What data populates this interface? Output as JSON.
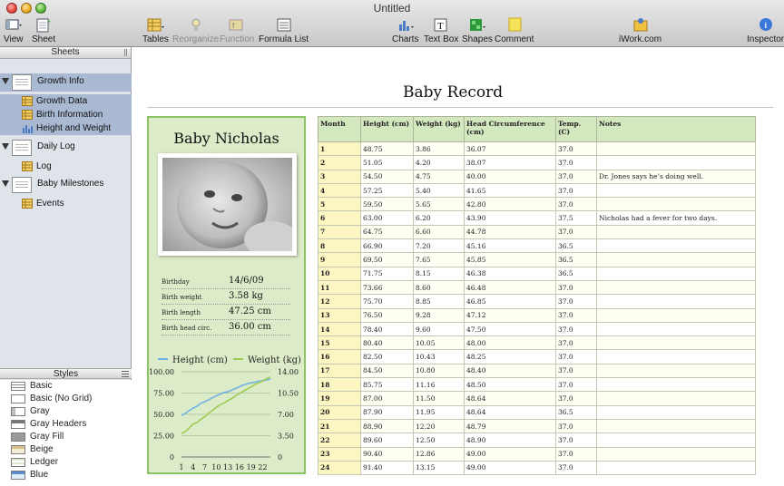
{
  "window": {
    "title": "Untitled"
  },
  "toolbar": {
    "view": "View",
    "sheet": "Sheet",
    "tables": "Tables",
    "reorganize": "Reorganize",
    "function": "Function",
    "formula_list": "Formula List",
    "charts": "Charts",
    "text_box": "Text Box",
    "shapes": "Shapes",
    "comment": "Comment",
    "iwork": "iWork.com",
    "inspector": "Inspector"
  },
  "sidebar": {
    "header": "Sheets",
    "sheets": [
      {
        "name": "Growth Info",
        "children": [
          "Growth Data",
          "Birth Information",
          "Height and Weight"
        ]
      },
      {
        "name": "Daily Log",
        "children": [
          "Log"
        ]
      },
      {
        "name": "Baby Milestones",
        "children": [
          "Events"
        ]
      }
    ]
  },
  "styles": {
    "header": "Styles",
    "items": [
      "Basic",
      "Basic (No Grid)",
      "Gray",
      "Gray Headers",
      "Gray Fill",
      "Beige",
      "Ledger",
      "Blue"
    ]
  },
  "document": {
    "title": "Baby Record"
  },
  "card": {
    "name": "Baby Nicholas",
    "rows": [
      {
        "label": "Birthday",
        "value": "14/6/09"
      },
      {
        "label": "Birth weight",
        "value": "3.58 kg"
      },
      {
        "label": "Birth length",
        "value": "47.25 cm"
      },
      {
        "label": "Birth head circ.",
        "value": "36.00 cm"
      }
    ]
  },
  "colors": {
    "height_line": "#6fb3e6",
    "weight_line": "#9ecb52",
    "accent_green": "#89c365"
  },
  "chart_data": {
    "type": "line",
    "x": [
      1,
      2,
      3,
      4,
      5,
      6,
      7,
      8,
      9,
      10,
      11,
      12,
      13,
      14,
      15,
      16,
      17,
      18,
      19,
      20,
      21,
      22,
      23,
      24
    ],
    "x_ticks": [
      "1",
      "4",
      "7",
      "10",
      "13",
      "16",
      "19",
      "22"
    ],
    "y_left_ticks": [
      "100.00",
      "75.00",
      "50.00",
      "25.00",
      "0"
    ],
    "y_right_ticks": [
      "14.00",
      "10.50",
      "7.00",
      "3.50",
      "0"
    ],
    "ylim_left": [
      0,
      100
    ],
    "ylim_right": [
      0,
      14
    ],
    "series": [
      {
        "name": "Height  (cm)",
        "axis": "left",
        "values": [
          48.75,
          51.05,
          54.5,
          57.25,
          59.5,
          63.0,
          64.75,
          66.9,
          69.5,
          71.75,
          73.66,
          75.7,
          76.5,
          78.4,
          80.4,
          82.5,
          84.5,
          85.75,
          87.0,
          87.9,
          88.9,
          89.6,
          90.4,
          91.4
        ]
      },
      {
        "name": "Weight  (kg)",
        "axis": "right",
        "values": [
          3.86,
          4.2,
          4.75,
          5.4,
          5.65,
          6.2,
          6.6,
          7.2,
          7.65,
          8.15,
          8.6,
          8.85,
          9.28,
          9.6,
          10.05,
          10.43,
          10.8,
          11.16,
          11.5,
          11.95,
          12.2,
          12.5,
          12.86,
          13.15
        ]
      }
    ],
    "grid": true,
    "legend": "top"
  },
  "table": {
    "headers": [
      "Month",
      "Height  (cm)",
      "Weight  (kg)",
      "Head Circumference (cm)",
      "Temp. (C)",
      "Notes"
    ],
    "rows": [
      [
        "1",
        "48.75",
        "3.86",
        "36.07",
        "37.0",
        ""
      ],
      [
        "2",
        "51.05",
        "4.20",
        "38.07",
        "37.0",
        ""
      ],
      [
        "3",
        "54.50",
        "4.75",
        "40.00",
        "37.0",
        "Dr. Jones says he’s doing well."
      ],
      [
        "4",
        "57.25",
        "5.40",
        "41.65",
        "37.0",
        ""
      ],
      [
        "5",
        "59.50",
        "5.65",
        "42.80",
        "37.0",
        ""
      ],
      [
        "6",
        "63.00",
        "6.20",
        "43.90",
        "37.5",
        "Nicholas had a fever for two days."
      ],
      [
        "7",
        "64.75",
        "6.60",
        "44.78",
        "37.0",
        ""
      ],
      [
        "8",
        "66.90",
        "7.20",
        "45.16",
        "36.5",
        ""
      ],
      [
        "9",
        "69.50",
        "7.65",
        "45.85",
        "36.5",
        ""
      ],
      [
        "10",
        "71.75",
        "8.15",
        "46.38",
        "36.5",
        ""
      ],
      [
        "11",
        "73.66",
        "8.60",
        "46.48",
        "37.0",
        ""
      ],
      [
        "12",
        "75.70",
        "8.85",
        "46.85",
        "37.0",
        ""
      ],
      [
        "13",
        "76.50",
        "9.28",
        "47.12",
        "37.0",
        ""
      ],
      [
        "14",
        "78.40",
        "9.60",
        "47.50",
        "37.0",
        ""
      ],
      [
        "15",
        "80.40",
        "10.05",
        "48.00",
        "37.0",
        ""
      ],
      [
        "16",
        "82.50",
        "10.43",
        "48.25",
        "37.0",
        ""
      ],
      [
        "17",
        "84.50",
        "10.80",
        "48.40",
        "37.0",
        ""
      ],
      [
        "18",
        "85.75",
        "11.16",
        "48.50",
        "37.0",
        ""
      ],
      [
        "19",
        "87.00",
        "11.50",
        "48.64",
        "37.0",
        ""
      ],
      [
        "20",
        "87.90",
        "11.95",
        "48.64",
        "36.5",
        ""
      ],
      [
        "21",
        "88.90",
        "12.20",
        "48.79",
        "37.0",
        ""
      ],
      [
        "22",
        "89.60",
        "12.50",
        "48.90",
        "37.0",
        ""
      ],
      [
        "23",
        "90.40",
        "12.86",
        "49.00",
        "37.0",
        ""
      ],
      [
        "24",
        "91.40",
        "13.15",
        "49.00",
        "37.0",
        ""
      ]
    ]
  }
}
